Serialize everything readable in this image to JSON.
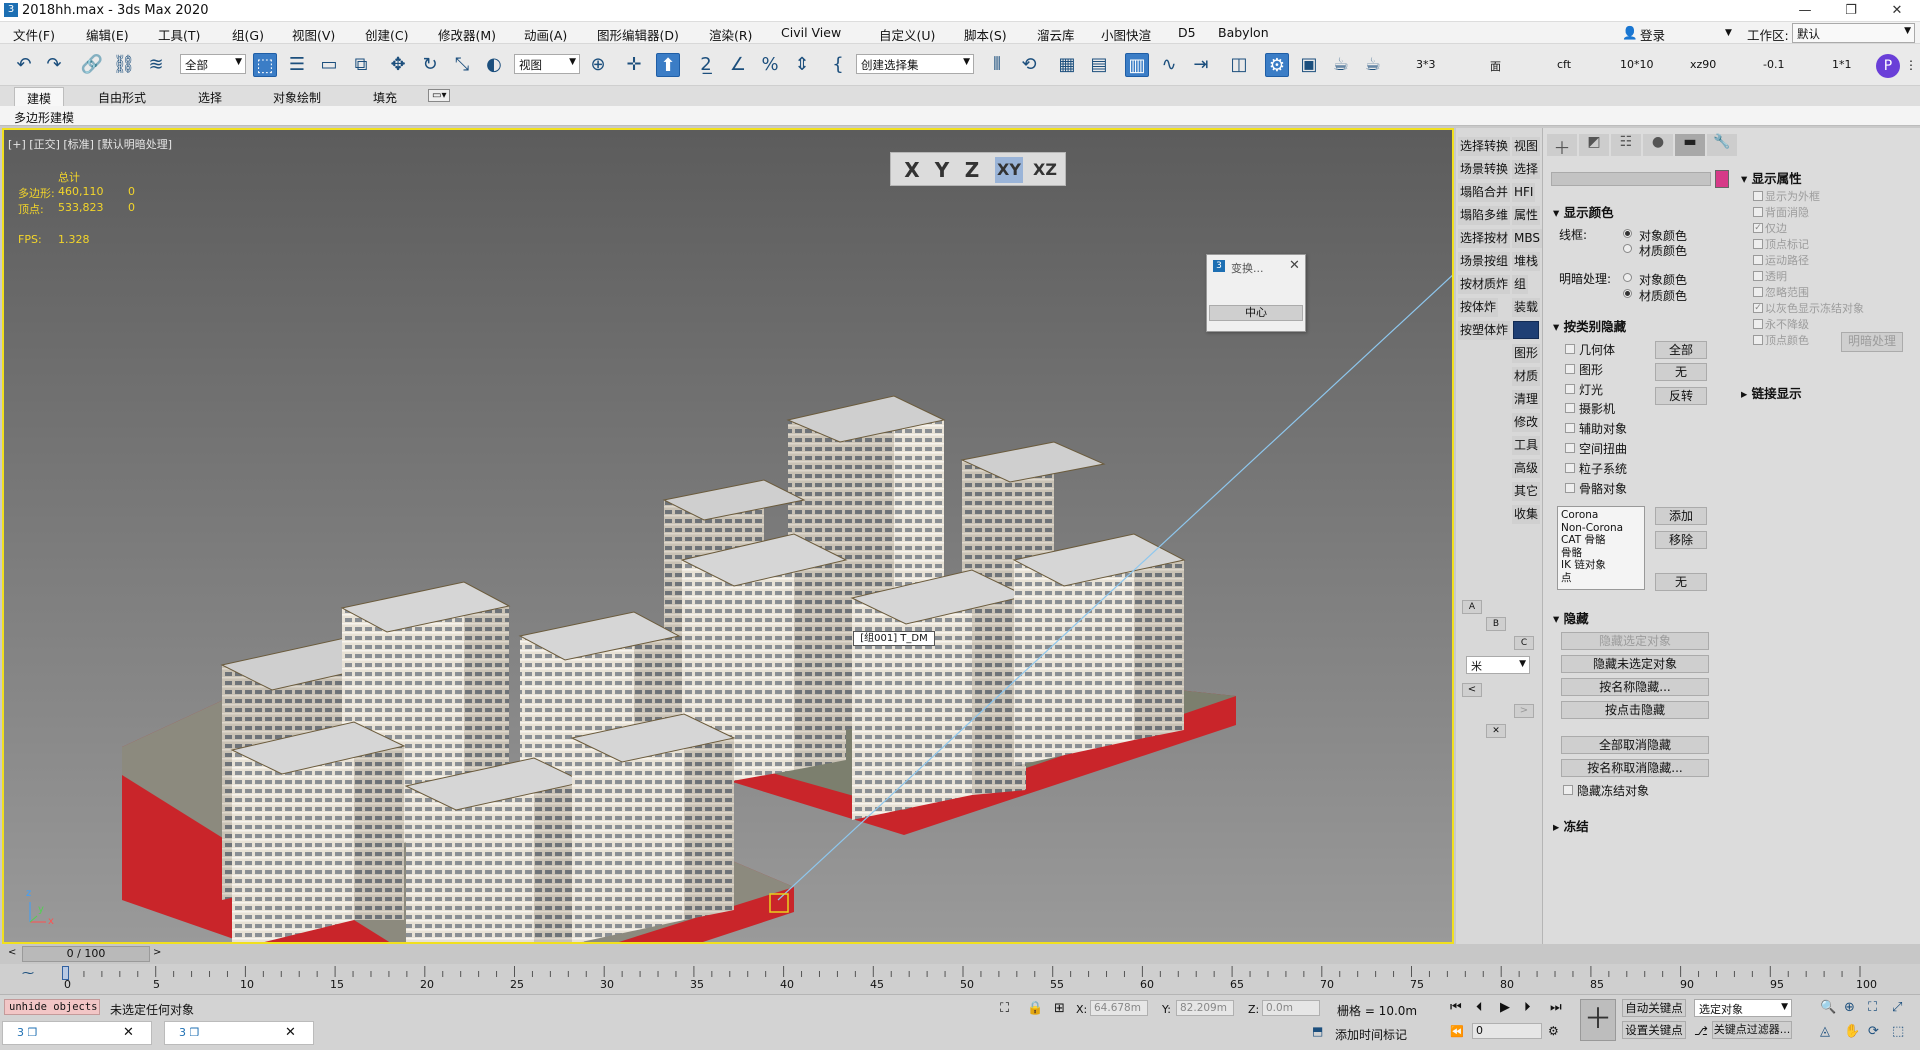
{
  "window": {
    "title": "2018hh.max - 3ds Max 2020",
    "app_icon": "3",
    "minimize": "—",
    "restore": "❐",
    "close": "✕"
  },
  "menu": [
    "文件(F)",
    "编辑(E)",
    "工具(T)",
    "组(G)",
    "视图(V)",
    "创建(C)",
    "修改器(M)",
    "动画(A)",
    "图形编辑器(D)",
    "渲染(R)",
    "Civil View",
    "自定义(U)",
    "脚本(S)",
    "溜云库",
    "小图快渲",
    "D5",
    "Babylon"
  ],
  "login": {
    "label": "登录",
    "workspace_label": "工作区:",
    "workspace_value": "默认"
  },
  "toolbar": {
    "selection_filter": "全部",
    "ref_coord": "视图",
    "named_selection": "创建选择集",
    "custom_texts": [
      "3*3",
      "面",
      "cft",
      "10*10",
      "xz90",
      "-0.1",
      "1*1"
    ]
  },
  "ribbon": {
    "tabs": [
      "建模",
      "自由形式",
      "选择",
      "对象绘制",
      "填充"
    ],
    "active": "建模",
    "subtab": "多边形建模"
  },
  "viewport": {
    "label": "[+] [正交] [标准] [默认明暗处理]",
    "stats_header": "总计",
    "stats": [
      {
        "label": "多边形:",
        "total": "460,110",
        "selected": "0"
      },
      {
        "label": "顶点:",
        "total": "533,823",
        "selected": "0"
      }
    ],
    "fps_label": "FPS:",
    "fps": "1.328",
    "tag": "[组001] T_DM",
    "axes": {
      "x": "x",
      "y": "y",
      "z": "z"
    }
  },
  "axis_constraints": {
    "buttons": [
      "X",
      "Y",
      "Z",
      "XY",
      "XZ"
    ],
    "active": "XY"
  },
  "transform_dialog": {
    "title": "变换...",
    "button": "中心"
  },
  "midcol": {
    "left_buttons": [
      "选择转换",
      "场景转换",
      "塌陷合并",
      "塌陷多维",
      "选择按材",
      "场景按组",
      "按材质炸",
      "按体炸",
      "按塑体炸"
    ],
    "right_buttons": [
      "视图",
      "选择",
      "HFI",
      "属性",
      "MBS",
      "堆栈",
      "组",
      "装载",
      "",
      "图形",
      "材质",
      "清理",
      "修改",
      "工具",
      "高级",
      "其它",
      "收集"
    ],
    "small_buttons": [
      "A",
      "B",
      "C"
    ],
    "unit_select": "米",
    "arrow_left": "<",
    "arrow_right": ">",
    "close": "✕"
  },
  "cmdpanel": {
    "display_color": {
      "title": "显示颜色",
      "wireframe_label": "线框:",
      "shaded_label": "明暗处理:",
      "options": [
        "对象颜色",
        "材质颜色"
      ],
      "wire_selected": "对象颜色",
      "shaded_selected": "材质颜色"
    },
    "hide_by_category": {
      "title": "按类别隐藏",
      "items": [
        "几何体",
        "图形",
        "灯光",
        "摄影机",
        "辅助对象",
        "空间扭曲",
        "粒子系统",
        "骨骼对象"
      ],
      "buttons": [
        "全部",
        "无",
        "反转"
      ],
      "list": [
        "Corona",
        "Non-Corona",
        "CAT 骨骼",
        "骨骼",
        "IK 链对象",
        "点"
      ],
      "list_buttons": [
        "添加",
        "移除",
        "无"
      ]
    },
    "hide": {
      "title": "隐藏",
      "buttons": [
        "隐藏选定对象",
        "隐藏未选定对象",
        "按名称隐藏...",
        "按点击隐藏",
        "全部取消隐藏",
        "按名称取消隐藏...",
        "隐藏冻结对象"
      ],
      "dim": [
        "隐藏选定对象"
      ]
    },
    "freeze": {
      "title": "冻结"
    },
    "display_props": {
      "title": "显示属性",
      "items": [
        {
          "label": "显示为外框",
          "checked": false
        },
        {
          "label": "背面消隐",
          "checked": false
        },
        {
          "label": "仅边",
          "checked": true
        },
        {
          "label": "顶点标记",
          "checked": false
        },
        {
          "label": "运动路径",
          "checked": false
        },
        {
          "label": "透明",
          "checked": false
        },
        {
          "label": "忽略范围",
          "checked": false
        },
        {
          "label": "以灰色显示冻结对象",
          "checked": true
        },
        {
          "label": "永不降级",
          "checked": false
        },
        {
          "label": "顶点颜色",
          "checked": false
        }
      ],
      "shade_button": "明暗处理"
    },
    "link_display": {
      "title": "链接显示"
    },
    "swatch_color": "#d63a88"
  },
  "timeline": {
    "frame": "0 / 100",
    "ticks": [
      "0",
      "5",
      "10",
      "15",
      "20",
      "25",
      "30",
      "35",
      "40",
      "45",
      "50",
      "55",
      "60",
      "65",
      "70",
      "75",
      "80",
      "85",
      "90",
      "95",
      "100"
    ]
  },
  "status": {
    "script_listener": "unhide objects",
    "message": "未选定任何对象",
    "x_label": "X:",
    "x_value": "64.678m",
    "y_label": "Y:",
    "y_value": "82.209m",
    "z_label": "Z:",
    "z_value": "0.0m",
    "grid": "栅格 = 10.0m",
    "add_time_tag": "添加时间标记",
    "auto_key": "自动关键点",
    "set_key": "设置关键点",
    "key_filter_select": "选定对象",
    "key_filters": "关键点过滤器...",
    "frame_field": "0"
  }
}
